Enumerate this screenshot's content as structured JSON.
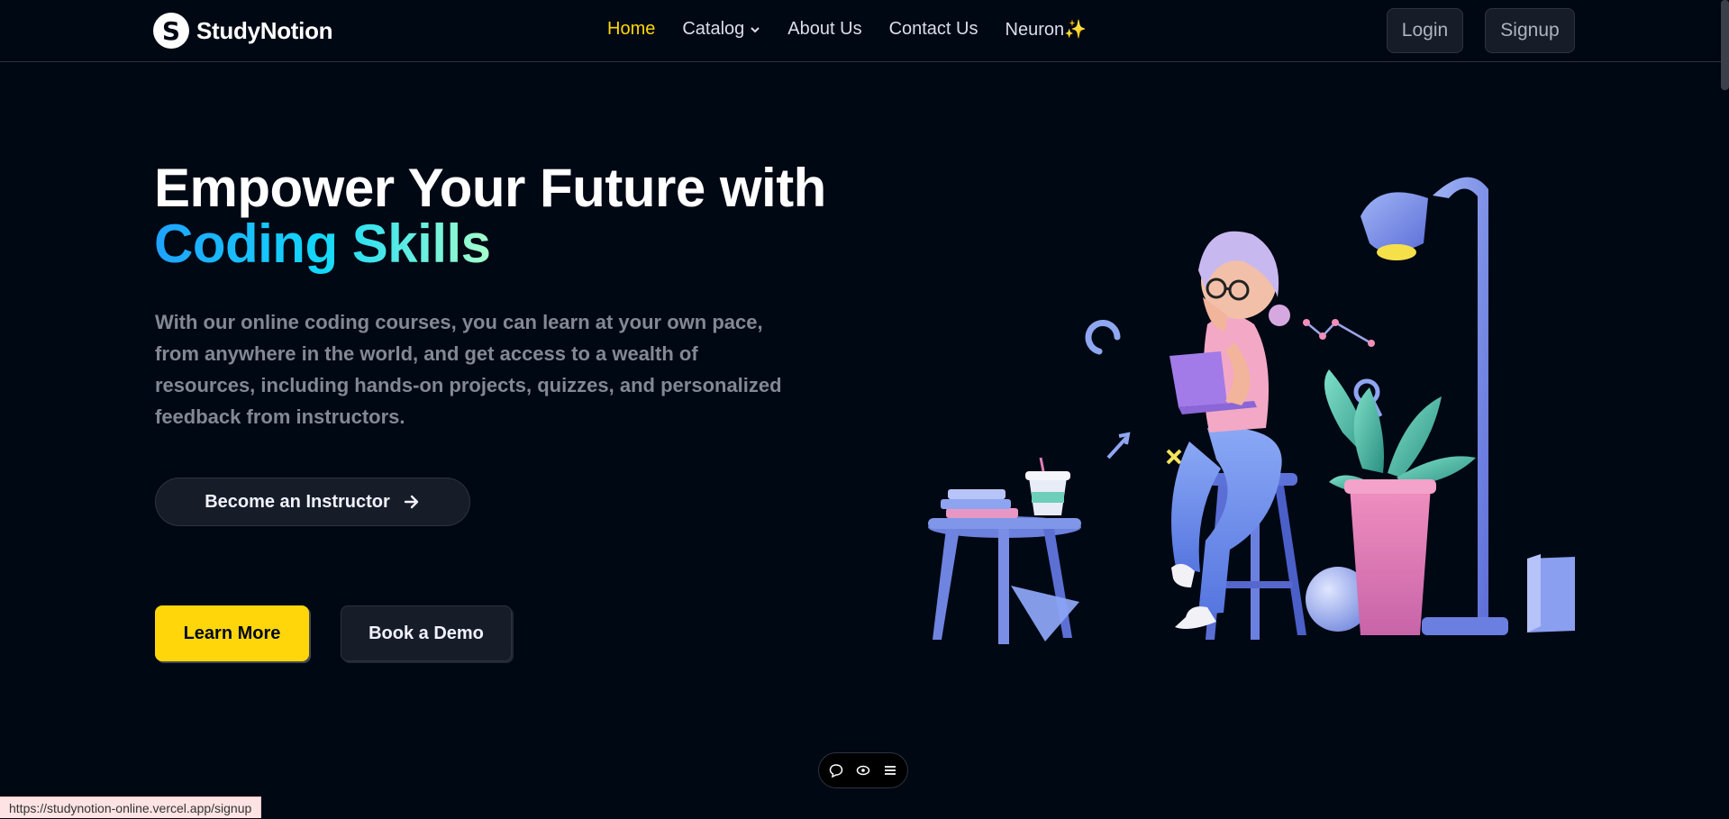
{
  "brand": {
    "name": "StudyNotion",
    "mark": "S"
  },
  "nav": {
    "items": [
      {
        "label": "Home",
        "active": true
      },
      {
        "label": "Catalog",
        "has_dropdown": true
      },
      {
        "label": "About Us"
      },
      {
        "label": "Contact Us"
      },
      {
        "label": "Neuron✨"
      }
    ]
  },
  "auth": {
    "login_label": "Login",
    "signup_label": "Signup"
  },
  "hero": {
    "title_line1": "Empower Your Future with",
    "title_line2": "Coding Skills",
    "description": "With our online coding courses, you can learn at your own pace, from anywhere in the world, and get access to a wealth of resources, including hands-on projects, quizzes, and personalized feedback from instructors.",
    "instructor_button": "Become an Instructor",
    "learn_more": "Learn More",
    "book_demo": "Book a Demo"
  },
  "toolbar": {
    "icons": [
      "chat-icon",
      "eye-icon",
      "menu-icon"
    ]
  },
  "statusbar": {
    "url": "https://studynotion-online.vercel.app/signup"
  },
  "colors": {
    "background": "#000814",
    "accent_yellow": "#ffd60a",
    "gradient_start": "#1fa2ff",
    "gradient_end": "#a6ffcb",
    "muted_text": "#838894",
    "button_dark": "#161d29"
  }
}
